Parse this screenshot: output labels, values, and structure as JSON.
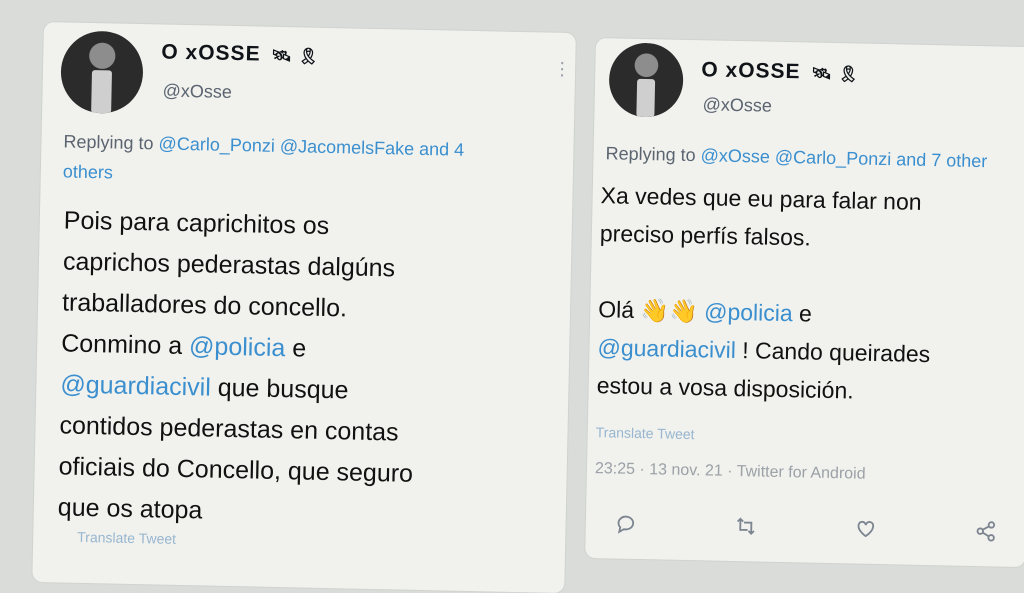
{
  "left_tweet": {
    "display_name": "O xOSSE",
    "badges": "🛰 🎗",
    "handle": "@xOsse",
    "reply_prefix": "Replying to",
    "reply_mentions": "@Carlo_Ponzi @JacomelsFake and 4",
    "reply_others": "others",
    "body_lines": [
      "Pois para caprichitos os",
      "caprichos pederastas dalgúns",
      "traballadores do concello.",
      "Conmino a",
      "@policia",
      "e",
      "@guardiacivil",
      "que busque",
      "contidos pederastas en contas",
      "oficiais do Concello,  que seguro",
      "que os atopa"
    ],
    "translate": "Translate Tweet"
  },
  "right_tweet": {
    "display_name": "O xOSSE",
    "badges": "🛰 🎗",
    "handle": "@xOsse",
    "reply_prefix": "Replying to",
    "reply_mentions": "@xOsse @Carlo_Ponzi and 7 other",
    "body_line_1": "Xa vedes que eu para falar non",
    "body_line_2": "preciso perfís falsos.",
    "ola": "Olá",
    "emoji": "👋👋",
    "mention_policia": "@policia",
    "e": "e",
    "mention_guardiacivil": "@guardiacivil",
    "line_4_rest": "! Cando queirades",
    "line_5": "estou a vosa disposición.",
    "translate": "Translate Tweet",
    "meta": "23:25 · 13 nov. 21 · Twitter for Android",
    "icons": {
      "reply": "reply-icon",
      "retweet": "retweet-icon",
      "like": "like-icon",
      "share": "share-icon"
    }
  }
}
